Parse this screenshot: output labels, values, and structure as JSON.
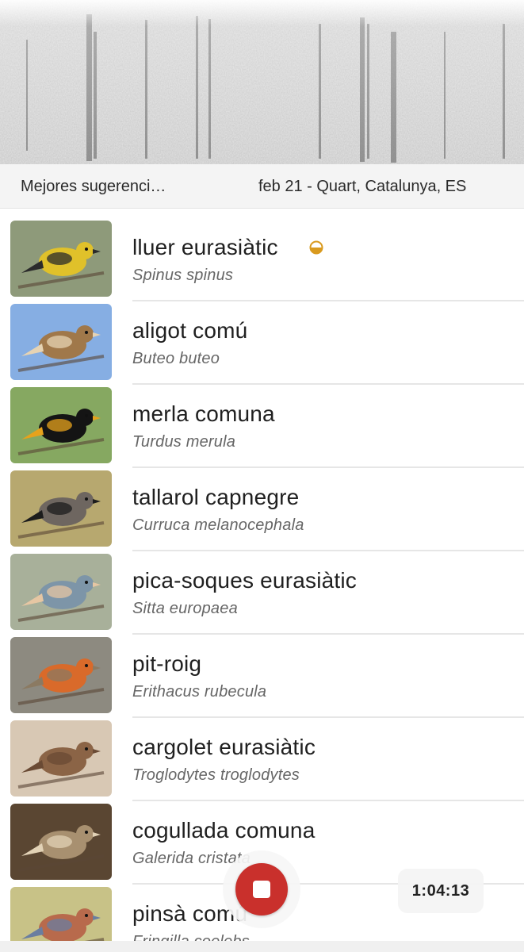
{
  "header": {
    "label": "Mejores sugerenci…",
    "date_location": "feb 21 - Quart, Catalunya, ES"
  },
  "colors": {
    "record": "#c9302c",
    "confidence": "#d99a1e"
  },
  "species": [
    {
      "name": "lluer eurasiàtic",
      "scientific": "Spinus spinus",
      "confidence_icon": "half-circle-icon",
      "bg": "#8e9a7a",
      "bird": "#e0c12a",
      "bird2": "#2b2b2b"
    },
    {
      "name": "aligot comú",
      "scientific": "Buteo buteo",
      "bg": "#86aee3",
      "bird": "#a0784a",
      "bird2": "#e6d3b3"
    },
    {
      "name": "merla comuna",
      "scientific": "Turdus merula",
      "bg": "#86a861",
      "bird": "#141414",
      "bird2": "#e6a21c"
    },
    {
      "name": "tallarol capnegre",
      "scientific": "Curruca melanocephala",
      "bg": "#b7a86f",
      "bird": "#6e6660",
      "bird2": "#1c1c1c"
    },
    {
      "name": "pica-soques eurasiàtic",
      "scientific": "Sitta europaea",
      "bg": "#a8b09a",
      "bird": "#7d95a8",
      "bird2": "#e6c6a3"
    },
    {
      "name": "pit-roig",
      "scientific": "Erithacus rubecula",
      "bg": "#8d8a80",
      "bird": "#d96a2a",
      "bird2": "#8b7a62"
    },
    {
      "name": "cargolet eurasiàtic",
      "scientific": "Troglodytes troglodytes",
      "bg": "#d8c8b4",
      "bird": "#8b6446",
      "bird2": "#6a4a34"
    },
    {
      "name": "cogullada comuna",
      "scientific": "Galerida cristata",
      "bg": "#5a4632",
      "bird": "#a89070",
      "bird2": "#e2d2b6"
    },
    {
      "name": "pinsà comú",
      "scientific": "Fringilla coelebs",
      "bg": "#c8c287",
      "bird": "#b86a4c",
      "bird2": "#6a7ea0"
    }
  ],
  "controls": {
    "record_button": "stop-icon",
    "timer": "1:04:13"
  }
}
